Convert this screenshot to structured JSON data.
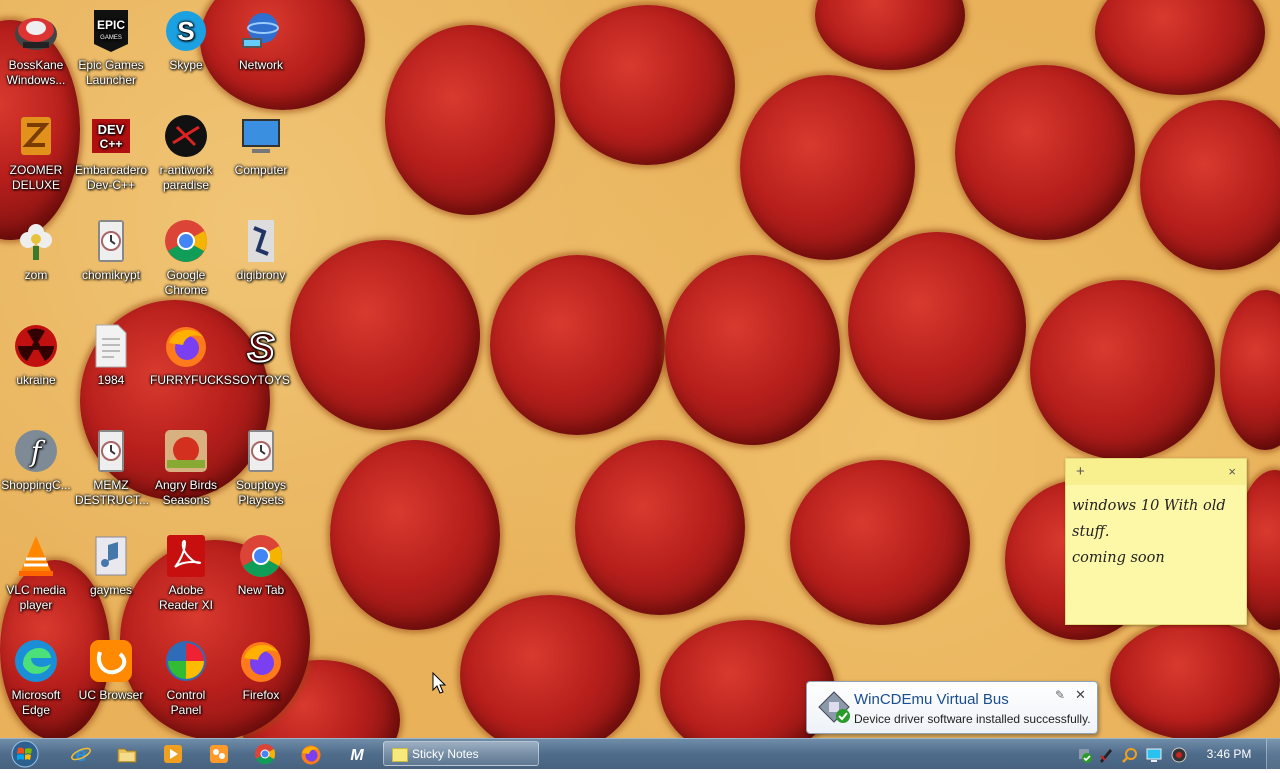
{
  "desktop": {
    "icons": [
      {
        "label": "BossKane\nWindows...",
        "icon": "bosskane-icon"
      },
      {
        "label": "Epic Games\nLauncher",
        "icon": "epic-games-icon"
      },
      {
        "label": "Skype",
        "icon": "skype-icon"
      },
      {
        "label": "Network",
        "icon": "network-icon"
      },
      {
        "label": "ZOOMER\nDELUXE",
        "icon": "zoomer-icon"
      },
      {
        "label": "Embarcadero\nDev-C++",
        "icon": "devcpp-icon"
      },
      {
        "label": "r-antiwork\nparadise",
        "icon": "r-antiwork-icon"
      },
      {
        "label": "Computer",
        "icon": "computer-icon"
      },
      {
        "label": "zom",
        "icon": "zom-icon"
      },
      {
        "label": "chomikrypt",
        "icon": "setup-icon"
      },
      {
        "label": "Google\nChrome",
        "icon": "chrome-icon"
      },
      {
        "label": "digibrony",
        "icon": "digibrony-icon"
      },
      {
        "label": "ukraine",
        "icon": "radiation-icon"
      },
      {
        "label": "1984",
        "icon": "text-file-icon"
      },
      {
        "label": "FURRYFUCKS",
        "icon": "firefox-icon"
      },
      {
        "label": "SOYTOYS",
        "icon": "soytoys-icon"
      },
      {
        "label": "ShoppingC...",
        "icon": "flash-icon"
      },
      {
        "label": "MEMZ\nDESTRUCT...",
        "icon": "setup-icon"
      },
      {
        "label": "Angry Birds\nSeasons",
        "icon": "angry-birds-icon"
      },
      {
        "label": "Souptoys\nPlaysets",
        "icon": "setup-icon"
      },
      {
        "label": "VLC media\nplayer",
        "icon": "vlc-icon"
      },
      {
        "label": "gaymes",
        "icon": "gaymes-icon"
      },
      {
        "label": "Adobe\nReader XI",
        "icon": "adobe-reader-icon"
      },
      {
        "label": "New Tab",
        "icon": "chrome-icon"
      },
      {
        "label": "Microsoft\nEdge",
        "icon": "edge-icon"
      },
      {
        "label": "UC Browser",
        "icon": "uc-browser-icon"
      },
      {
        "label": "Control\nPanel",
        "icon": "control-panel-icon"
      },
      {
        "label": "Firefox",
        "icon": "firefox-icon"
      }
    ]
  },
  "sticky_note": {
    "lines": [
      "windows 10 With old",
      "stuff.",
      "coming soon"
    ],
    "add_symbol": "+",
    "close_symbol": "×"
  },
  "notification": {
    "title": "WinCDEmu Virtual Bus",
    "message": "Device driver software installed successfully.",
    "pin_symbol": "✎",
    "close_symbol": "✕"
  },
  "taskbar": {
    "pinned": [
      "internet-explorer-icon",
      "explorer-folder-icon",
      "media-player-icon",
      "paint-icon",
      "chrome-icon",
      "firefox-icon",
      "m-icon"
    ],
    "active_task": "Sticky Notes",
    "tray": [
      "driver-check-icon",
      "pen-icon",
      "search-icon",
      "monitor-icon",
      "volume-icon"
    ],
    "clock": "3:46 PM"
  }
}
